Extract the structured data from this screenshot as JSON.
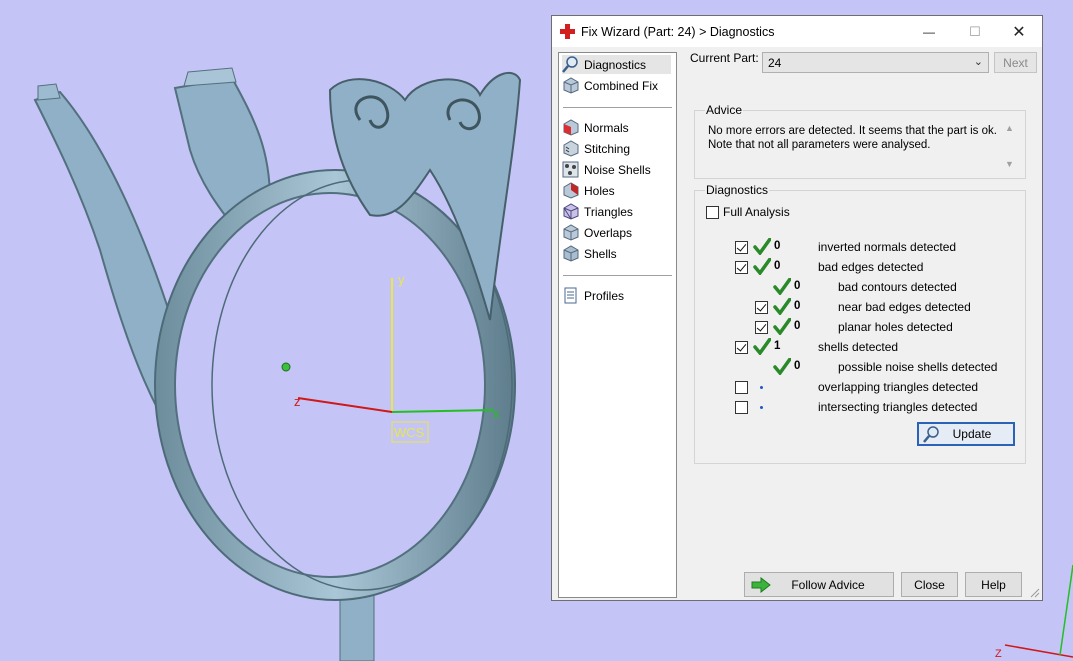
{
  "viewport": {
    "axis_labels": {
      "x": "x",
      "y": "y",
      "z": "z",
      "wcs": "WCS"
    },
    "corner_axis_label": "Z",
    "colors": {
      "background": "#c4c4f6",
      "model": "#8fb0c6",
      "model_dark": "#52707e"
    }
  },
  "dialog": {
    "title": "Fix Wizard (Part: 24) > Diagnostics",
    "window_buttons": {
      "minimize": "—",
      "maximize": "☐",
      "close": "✕"
    },
    "nav": {
      "top": [
        {
          "label": "Diagnostics",
          "icon": "magnifier-icon"
        },
        {
          "label": "Combined Fix",
          "icon": "cube-icon"
        }
      ],
      "tools": [
        {
          "label": "Normals",
          "icon": "normals-cube-icon"
        },
        {
          "label": "Stitching",
          "icon": "stitching-cube-icon"
        },
        {
          "label": "Noise Shells",
          "icon": "noise-shells-icon"
        },
        {
          "label": "Holes",
          "icon": "holes-cube-icon"
        },
        {
          "label": "Triangles",
          "icon": "triangles-cube-icon"
        },
        {
          "label": "Overlaps",
          "icon": "overlaps-cube-icon"
        },
        {
          "label": "Shells",
          "icon": "shells-cube-icon"
        }
      ],
      "bottom": [
        {
          "label": "Profiles",
          "icon": "document-icon"
        }
      ]
    },
    "current_part_label": "Current Part:",
    "current_part_value": "24",
    "next_label": "Next",
    "advice": {
      "title": "Advice",
      "text_line1": "No more errors are detected. It seems that the part is ok.",
      "text_line2": "Note that not all parameters were analysed."
    },
    "diagnostics": {
      "title": "Diagnostics",
      "full_analysis_label": "Full Analysis",
      "rows": [
        {
          "label": "inverted normals detected",
          "count": "0",
          "checkbox": true,
          "checked": true,
          "status": "ok",
          "indent": 0
        },
        {
          "label": "bad edges detected",
          "count": "0",
          "checkbox": true,
          "checked": true,
          "status": "ok",
          "indent": 0
        },
        {
          "label": "bad contours detected",
          "count": "0",
          "checkbox": false,
          "checked": false,
          "status": "ok",
          "indent": 1
        },
        {
          "label": "near bad edges detected",
          "count": "0",
          "checkbox": true,
          "checked": true,
          "status": "ok",
          "indent": 1
        },
        {
          "label": "planar holes detected",
          "count": "0",
          "checkbox": true,
          "checked": true,
          "status": "ok",
          "indent": 1
        },
        {
          "label": "shells detected",
          "count": "1",
          "checkbox": true,
          "checked": true,
          "status": "ok",
          "indent": 0
        },
        {
          "label": "possible noise shells detected",
          "count": "0",
          "checkbox": false,
          "checked": false,
          "status": "ok",
          "indent": 1
        },
        {
          "label": "overlapping triangles detected",
          "count": "",
          "checkbox": true,
          "checked": false,
          "status": "pending",
          "indent": 0
        },
        {
          "label": "intersecting triangles detected",
          "count": "",
          "checkbox": true,
          "checked": false,
          "status": "pending",
          "indent": 0
        }
      ],
      "update_label": "Update"
    },
    "footer": {
      "follow_advice_label": "Follow Advice",
      "close_label": "Close",
      "help_label": "Help"
    },
    "colors": {
      "check_green": "#2a8a2a",
      "arrow_green": "#3cb43c",
      "title_icon_red": "#d22020",
      "dot_blue": "#2255cc"
    }
  }
}
